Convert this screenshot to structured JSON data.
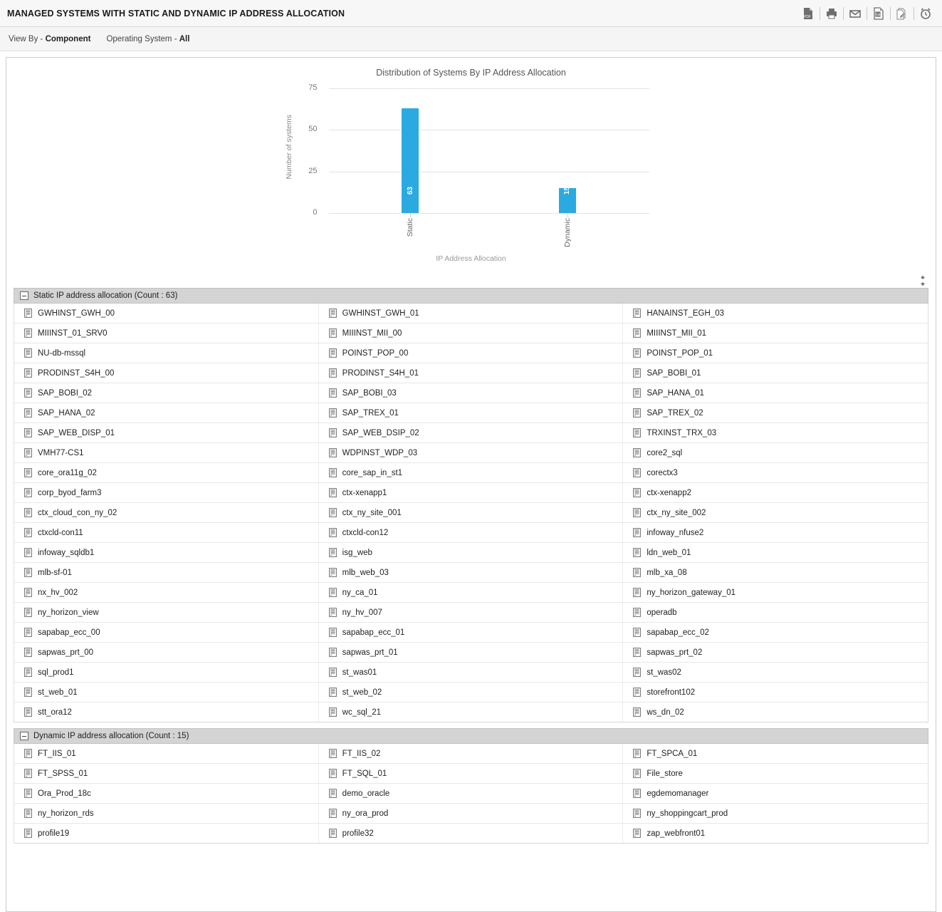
{
  "header": {
    "title": "MANAGED SYSTEMS WITH STATIC AND DYNAMIC IP ADDRESS ALLOCATION",
    "toolbar": [
      {
        "name": "export-pdf-icon",
        "label": "PDF"
      },
      {
        "name": "print-icon",
        "label": "Print"
      },
      {
        "name": "email-icon",
        "label": "Email"
      },
      {
        "name": "export-excel-icon",
        "label": "Excel"
      },
      {
        "name": "annotate-document-icon",
        "label": "Edit"
      },
      {
        "name": "schedule-alarm-icon",
        "label": "Schedule"
      }
    ]
  },
  "filters": [
    {
      "label": "View By - ",
      "value": "Component"
    },
    {
      "label": "Operating System - ",
      "value": "All"
    }
  ],
  "collapse_all_label": "Collapse All",
  "chart_data": {
    "type": "bar",
    "title": "Distribution of Systems By IP Address Allocation",
    "xlabel": "IP Address Allocation",
    "ylabel": "Number of systems",
    "categories": [
      "Static",
      "Dynamic"
    ],
    "values": [
      63,
      15
    ],
    "ylim": [
      0,
      75
    ],
    "yticks": [
      "0",
      "25",
      "50",
      "75"
    ],
    "grid": true,
    "legend": "none",
    "bar_color": "#2aaae1"
  },
  "groups": [
    {
      "title": "Static IP address allocation (Count : 63)",
      "count": 63,
      "rows": [
        [
          "GWHINST_GWH_00",
          "GWHINST_GWH_01",
          "HANAINST_EGH_03"
        ],
        [
          "MIIINST_01_SRV0",
          "MIIINST_MII_00",
          "MIIINST_MII_01"
        ],
        [
          "NU-db-mssql",
          "POINST_POP_00",
          "POINST_POP_01"
        ],
        [
          "PRODINST_S4H_00",
          "PRODINST_S4H_01",
          "SAP_BOBI_01"
        ],
        [
          "SAP_BOBI_02",
          "SAP_BOBI_03",
          "SAP_HANA_01"
        ],
        [
          "SAP_HANA_02",
          "SAP_TREX_01",
          "SAP_TREX_02"
        ],
        [
          "SAP_WEB_DISP_01",
          "SAP_WEB_DSIP_02",
          "TRXINST_TRX_03"
        ],
        [
          "VMH77-CS1",
          "WDPINST_WDP_03",
          "core2_sql"
        ],
        [
          "core_ora11g_02",
          "core_sap_in_st1",
          "corectx3"
        ],
        [
          "corp_byod_farm3",
          "ctx-xenapp1",
          "ctx-xenapp2"
        ],
        [
          "ctx_cloud_con_ny_02",
          "ctx_ny_site_001",
          "ctx_ny_site_002"
        ],
        [
          "ctxcld-con11",
          "ctxcld-con12",
          "infoway_nfuse2"
        ],
        [
          "infoway_sqldb1",
          "isg_web",
          "ldn_web_01"
        ],
        [
          "mlb-sf-01",
          "mlb_web_03",
          "mlb_xa_08"
        ],
        [
          "nx_hv_002",
          "ny_ca_01",
          "ny_horizon_gateway_01"
        ],
        [
          "ny_horizon_view",
          "ny_hv_007",
          "operadb"
        ],
        [
          "sapabap_ecc_00",
          "sapabap_ecc_01",
          "sapabap_ecc_02"
        ],
        [
          "sapwas_prt_00",
          "sapwas_prt_01",
          "sapwas_prt_02"
        ],
        [
          "sql_prod1",
          "st_was01",
          "st_was02"
        ],
        [
          "st_web_01",
          "st_web_02",
          "storefront102"
        ],
        [
          "stt_ora12",
          "wc_sql_21",
          "ws_dn_02"
        ]
      ]
    },
    {
      "title": "Dynamic IP address allocation (Count : 15)",
      "count": 15,
      "rows": [
        [
          "FT_IIS_01",
          "FT_IIS_02",
          "FT_SPCA_01"
        ],
        [
          "FT_SPSS_01",
          "FT_SQL_01",
          "File_store"
        ],
        [
          "Ora_Prod_18c",
          "demo_oracle",
          "egdemomanager"
        ],
        [
          "ny_horizon_rds",
          "ny_ora_prod",
          "ny_shoppingcart_prod"
        ],
        [
          "profile19",
          "profile32",
          "zap_webfront01"
        ]
      ]
    }
  ]
}
